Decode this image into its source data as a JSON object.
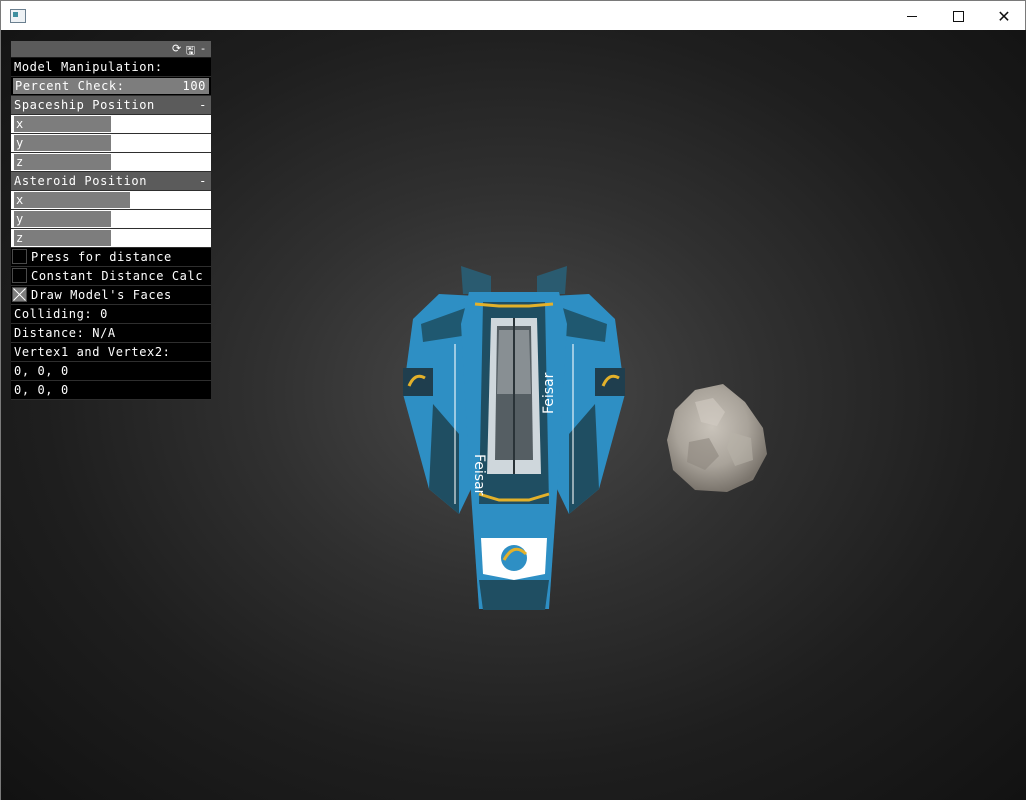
{
  "window": {
    "icon": "app-window-icon",
    "controls": {
      "minimize": "minimize-icon",
      "maximize": "maximize-icon",
      "close": "close-icon"
    },
    "close_glyph": "✕"
  },
  "panel": {
    "header_icons": [
      "refresh-icon",
      "save-icon",
      "collapse-icon"
    ],
    "header_glyphs": {
      "refresh": "⟳",
      "save": "🖫",
      "collapse": "-"
    },
    "model_manipulation_label": "Model Manipulation:",
    "percent_check": {
      "label": "Percent Check:",
      "value": "100"
    },
    "spaceship_position": {
      "title": "Spaceship Position",
      "collapse": "-",
      "x_label": "x",
      "y_label": "y",
      "z_label": "z",
      "x_fill": 0.5,
      "y_fill": 0.5,
      "z_fill": 0.5
    },
    "asteroid_position": {
      "title": "Asteroid Position",
      "collapse": "-",
      "x_label": "x",
      "y_label": "y",
      "z_label": "z",
      "x_fill": 0.6,
      "y_fill": 0.5,
      "z_fill": 0.5
    },
    "press_for_distance": {
      "label": "Press for distance",
      "checked": false
    },
    "constant_distance_calc": {
      "label": "Constant Distance Calc",
      "checked": false
    },
    "draw_model_faces": {
      "label": "Draw Model's Faces",
      "checked": true
    },
    "colliding": "Colliding: 0",
    "distance": "Distance: N/A",
    "vertex_label": "Vertex1 and Vertex2:",
    "vertex1": "0, 0, 0",
    "vertex2": "0, 0, 0"
  },
  "scene": {
    "ship_decal_text": "Feisar",
    "colors": {
      "ship_blue": "#2e8fc4",
      "ship_dark": "#1f4e62",
      "ship_yellow": "#e3b12a",
      "asteroid": "#a9a39a"
    }
  }
}
